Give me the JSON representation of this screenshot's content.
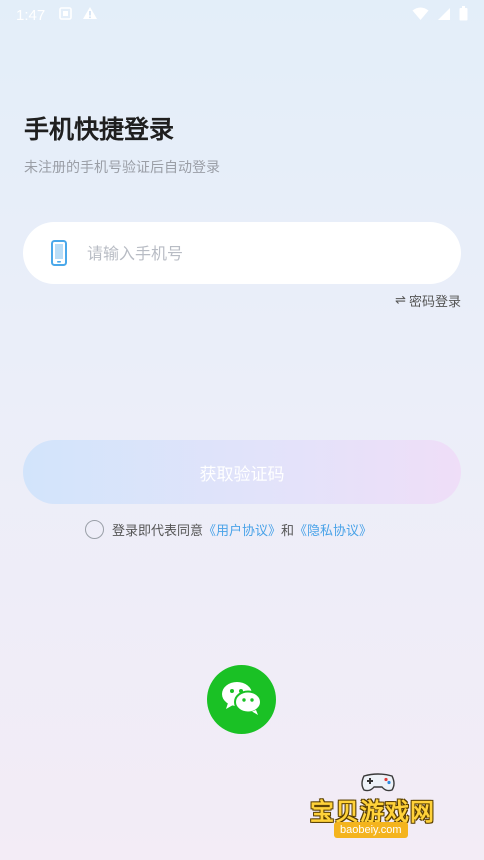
{
  "status_bar": {
    "time": "1:47",
    "icons": [
      "notification-icon",
      "warning-icon",
      "wifi-icon",
      "signal-icon",
      "battery-icon"
    ]
  },
  "login": {
    "title": "手机快捷登录",
    "subtitle": "未注册的手机号验证后自动登录",
    "phone_placeholder": "请输入手机号",
    "password_login_icon": "⇌",
    "password_login_label": "密码登录",
    "get_code_label": "获取验证码"
  },
  "agreement": {
    "prefix": "登录即代表同意",
    "user_agreement": "《用户协议》",
    "conjunction": "和",
    "privacy_agreement": "《隐私协议》"
  },
  "watermark": {
    "name": "宝贝游戏网",
    "url": "baobeiy.com"
  },
  "colors": {
    "accent_link": "#4aa3e8",
    "wechat_green": "#1ac125",
    "phone_icon": "#4aa8ea"
  }
}
